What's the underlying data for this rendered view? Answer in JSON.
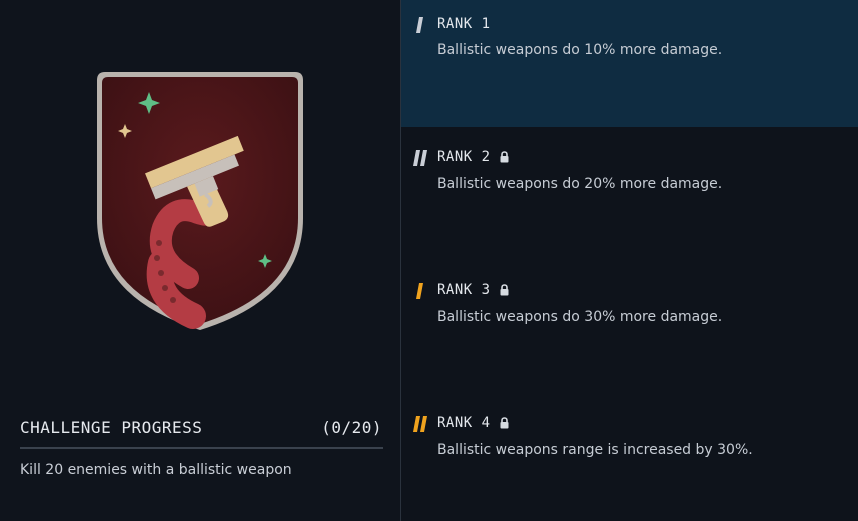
{
  "badge": {
    "icon": "ballistic-pistol-tentacle-patch"
  },
  "progress": {
    "title": "CHALLENGE PROGRESS",
    "count": "(0/20)",
    "description": "Kill 20 enemies with a ballistic weapon"
  },
  "ranks": [
    {
      "label": "RANK 1",
      "description": "Ballistic weapons do 10% more damage.",
      "locked": false,
      "tier_color": "#c9ced6"
    },
    {
      "label": "RANK 2",
      "description": "Ballistic weapons do 20% more damage.",
      "locked": true,
      "tier_color": "#c9ced6"
    },
    {
      "label": "RANK 3",
      "description": "Ballistic weapons do 30% more damage.",
      "locked": true,
      "tier_color": "#f0a31e"
    },
    {
      "label": "RANK 4",
      "description": "Ballistic weapons range is increased by 30%.",
      "locked": true,
      "tier_color": "#f0a31e"
    }
  ],
  "colors": {
    "active_bg": "#0f2c41",
    "badge_red": "#6b1d20",
    "gold": "#f0a31e"
  }
}
